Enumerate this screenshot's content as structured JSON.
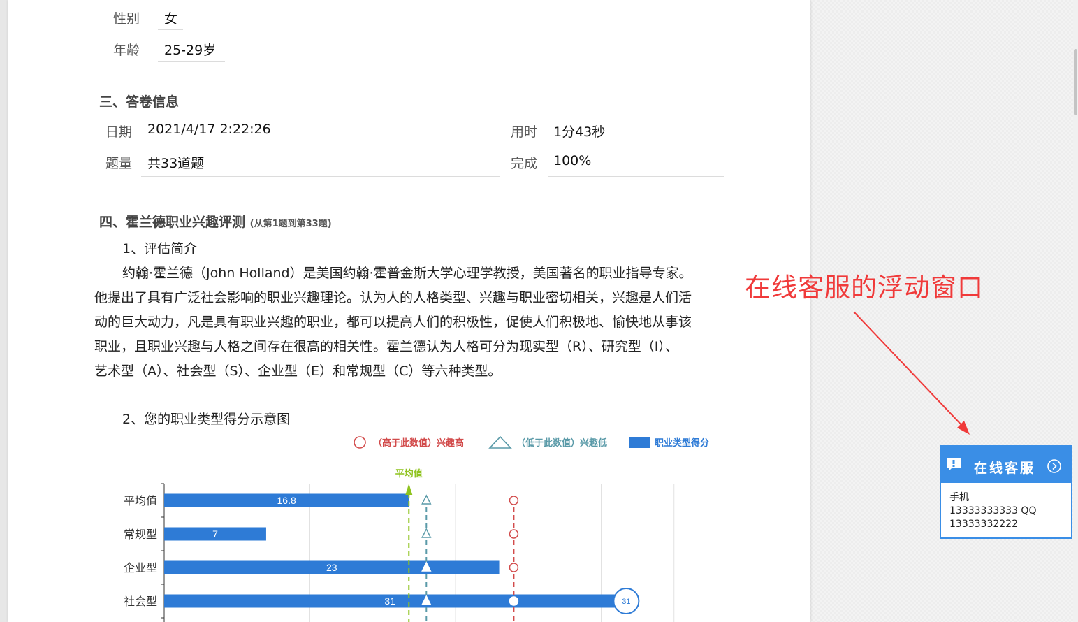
{
  "basic": {
    "gender_label": "性别",
    "gender_value": "女",
    "age_label": "年龄",
    "age_value": "25-29岁"
  },
  "answer_info": {
    "title": "三、答卷信息",
    "date_label": "日期",
    "date_value": "2021/4/17 2:22:26",
    "time_label": "用时",
    "time_value": "1分43秒",
    "count_label": "题量",
    "count_value": "共33道题",
    "done_label": "完成",
    "done_value": "100%"
  },
  "holland": {
    "title": "四、霍兰德职业兴趣评测",
    "range": "(从第1题到第33题)",
    "intro_heading": "1、评估简介",
    "intro_lines": [
      "约翰·霍兰德（John Holland）是美国约翰·霍普金斯大学心理学教授，美国著名的职业指导专家。",
      "他提出了具有广泛社会影响的职业兴趣理论。认为人的人格类型、兴趣与职业密切相关，兴趣是人们活",
      "动的巨大动力，凡是具有职业兴趣的职业，都可以提高人们的积极性，促使人们积极地、愉快地从事该",
      "职业，且职业兴趣与人格之间存在很高的相关性。霍兰德认为人格可分为现实型（R）、研究型（I）、",
      "艺术型（A）、社会型（S）、企业型（E）和常规型（C）等六种类型。"
    ],
    "chart_heading": "2、您的职业类型得分示意图"
  },
  "chart_data": {
    "type": "bar",
    "orientation": "horizontal",
    "categories": [
      "平均值",
      "常规型",
      "企业型",
      "社会型"
    ],
    "values": [
      16.8,
      7,
      23,
      31
    ],
    "value_labels": [
      "16.8",
      "7",
      "23",
      "31"
    ],
    "marker_label": "31",
    "legend": [
      {
        "symbol": "circle",
        "text": "（高于此数值）兴趣高",
        "color": "#d24b4b"
      },
      {
        "symbol": "triangle",
        "text": "（低于此数值）兴趣低",
        "color": "#5a9aa8"
      },
      {
        "symbol": "rect",
        "text": "职业类型得分",
        "color": "#2e7bd6"
      }
    ],
    "reference_lines": [
      {
        "name": "平均值",
        "value": 16.8,
        "color": "#8fc31f"
      },
      {
        "name": "low",
        "value": 18,
        "color": "#5a9aa8"
      },
      {
        "name": "high",
        "value": 24,
        "color": "#d24b4b"
      }
    ],
    "xlim": [
      0,
      35
    ],
    "bar_color": "#2e7bd6",
    "grid": true
  },
  "annotation": {
    "text": "在线客服的浮动窗口",
    "color": "#f03a3a"
  },
  "customer_service": {
    "title": "在线客服",
    "body_line1": "手机",
    "body_line2": "13333333333 QQ",
    "body_line3": "13333332222",
    "color": "#3a8ee6"
  }
}
